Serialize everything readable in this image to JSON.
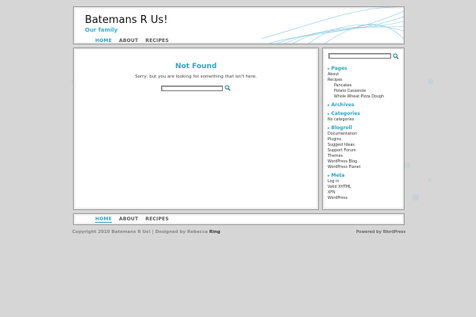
{
  "header": {
    "site_title": "Batemans R Us!",
    "tagline": "Our family"
  },
  "nav": [
    {
      "label": "HOME",
      "active": true
    },
    {
      "label": "ABOUT",
      "active": false
    },
    {
      "label": "RECIPES",
      "active": false
    }
  ],
  "main": {
    "title": "Not Found",
    "message": "Sorry, but you are looking for something that isn't here.",
    "search_value": ""
  },
  "sidebar": {
    "search_value": "",
    "pages_title": "Pages",
    "pages": [
      {
        "label": "About",
        "sub": false
      },
      {
        "label": "Recipes",
        "sub": false
      },
      {
        "label": "Pancakes",
        "sub": true
      },
      {
        "label": "Potato Casserole",
        "sub": true
      },
      {
        "label": "Whole Wheat Pizza Dough",
        "sub": true
      }
    ],
    "archives_title": "Archives",
    "categories_title": "Categories",
    "categories": [
      "No categories"
    ],
    "blogroll_title": "Blogroll",
    "blogroll": [
      "Documentation",
      "Plugins",
      "Suggest Ideas",
      "Support Forum",
      "Themes",
      "WordPress Blog",
      "WordPress Planet"
    ],
    "meta_title": "Meta",
    "meta": [
      "Log in",
      "Valid XHTML",
      "XFN",
      "WordPress"
    ]
  },
  "footer": {
    "copyright_prefix": "Copyright 2010 Batemans R Us! | Designed by Rebecca ",
    "designer_link": "Ring",
    "powered_prefix": "Powered by ",
    "powered_link": "WordPress"
  },
  "colors": {
    "accent": "#2aa5c6",
    "background": "#d6d6d6",
    "panel": "#ffffff"
  },
  "icons": [
    "search-icon",
    "bullet-arrow-icon"
  ]
}
